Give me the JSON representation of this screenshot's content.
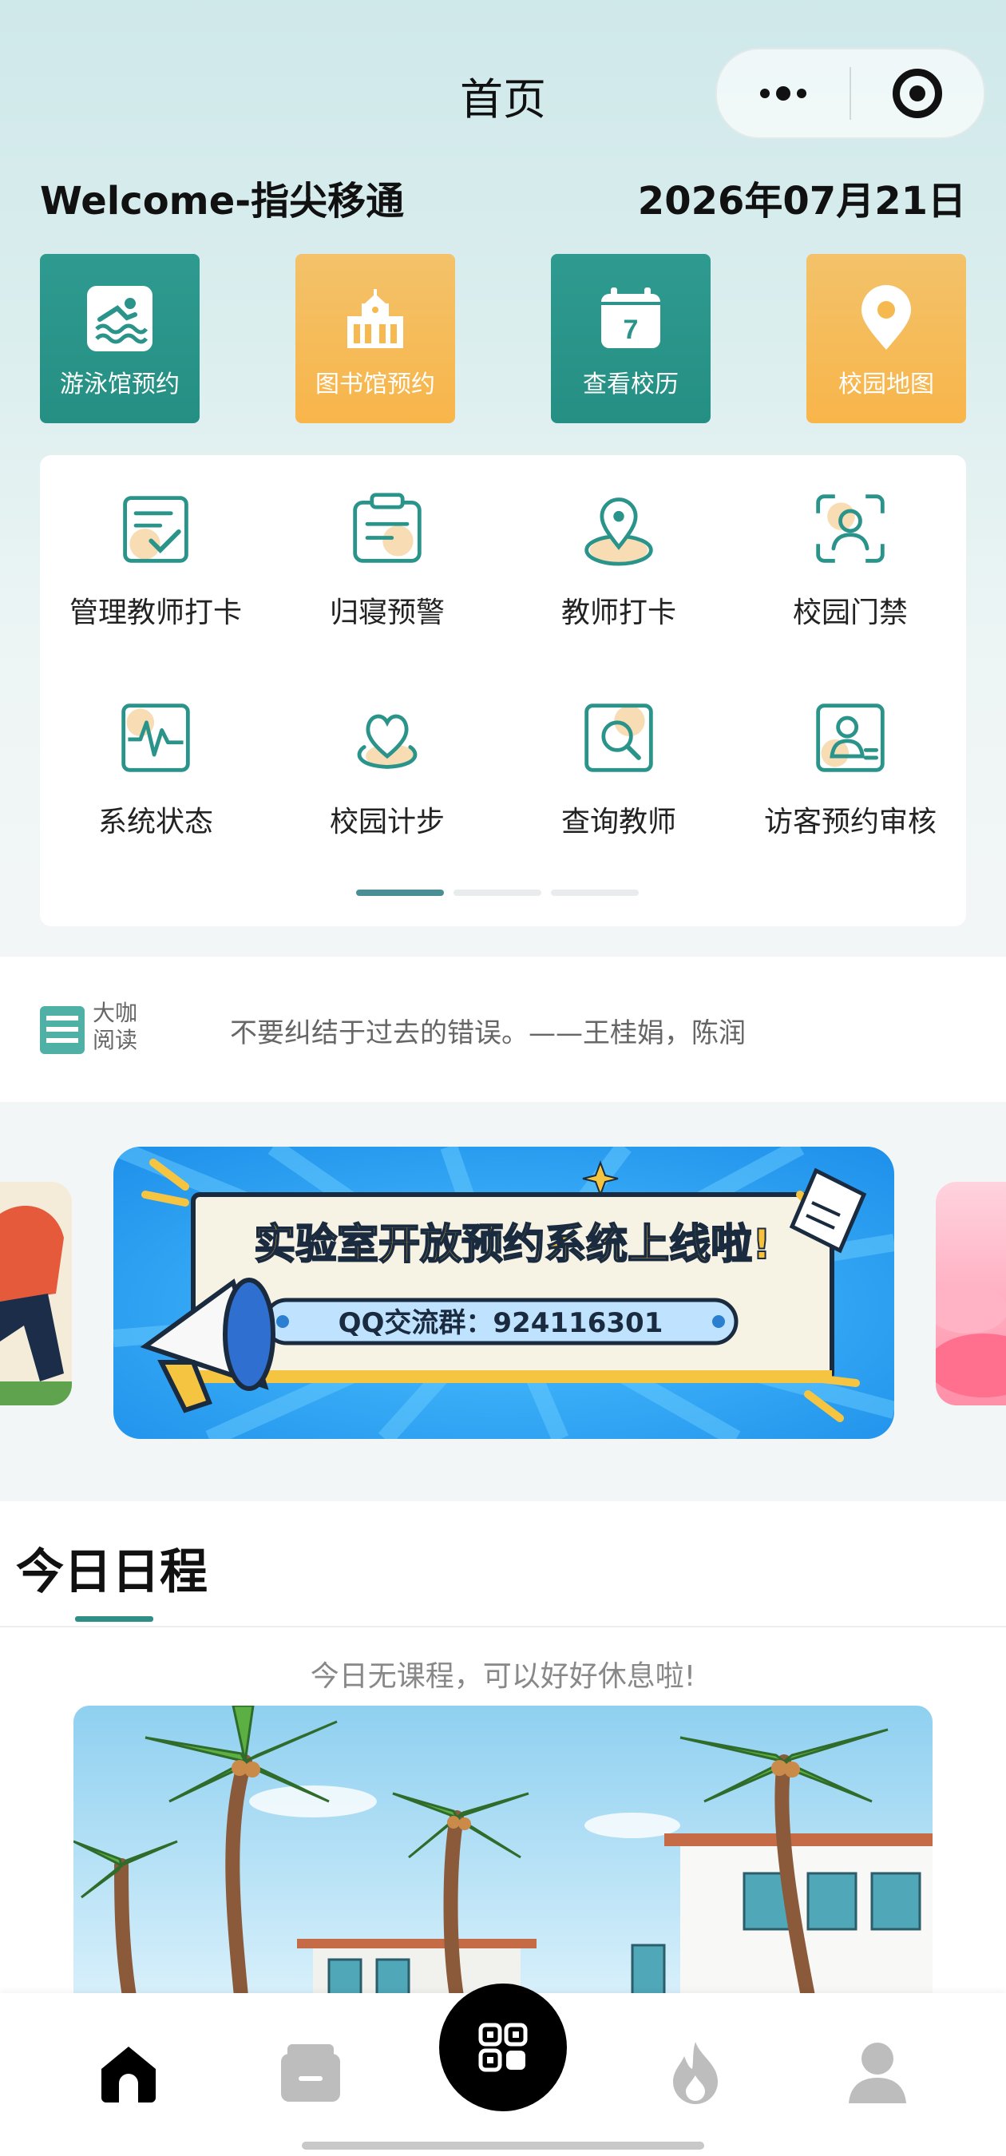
{
  "header": {
    "title": "首页",
    "welcome": "Welcome-指尖移通",
    "date": "2026年07月21日"
  },
  "capsule": {
    "more_icon": "more-dots-icon",
    "close_icon": "target-circle-icon"
  },
  "quick_tiles": [
    {
      "label": "游泳馆预约",
      "icon": "swimming-icon",
      "color": "#2a948a"
    },
    {
      "label": "图书馆预约",
      "icon": "library-building-icon",
      "color": "#f6b94f"
    },
    {
      "label": "查看校历",
      "icon": "calendar-icon",
      "color": "#2a948a"
    },
    {
      "label": "校园地图",
      "icon": "map-pin-icon",
      "color": "#f6b94f"
    }
  ],
  "grid_items": [
    {
      "label": "管理教师打卡",
      "icon": "checklist-icon"
    },
    {
      "label": "归寝预警",
      "icon": "clipboard-icon"
    },
    {
      "label": "教师打卡",
      "icon": "location-pin-icon"
    },
    {
      "label": "校园门禁",
      "icon": "face-scan-icon"
    },
    {
      "label": "系统状态",
      "icon": "pulse-monitor-icon"
    },
    {
      "label": "校园计步",
      "icon": "heart-pin-icon"
    },
    {
      "label": "查询教师",
      "icon": "search-doc-icon"
    },
    {
      "label": "访客预约审核",
      "icon": "id-card-icon"
    }
  ],
  "quote": {
    "logo_line1": "大咖",
    "logo_line2": "阅读",
    "text": "不要纠结于过去的错误。——王桂娟，陈润"
  },
  "banner": {
    "headline": "实验室开放预约系统上线啦!",
    "qq_group": "QQ交流群：924116301"
  },
  "schedule": {
    "title": "今日日程",
    "empty_text": "今日无课程，可以好好休息啦!"
  },
  "tabbar": {
    "items": [
      "home-icon",
      "wallet-icon",
      "apps-grid-icon",
      "fire-icon",
      "user-icon"
    ]
  },
  "colors": {
    "accent": "#2d8f86",
    "amber": "#f6b94f",
    "pager_active": "#4a8f95"
  }
}
